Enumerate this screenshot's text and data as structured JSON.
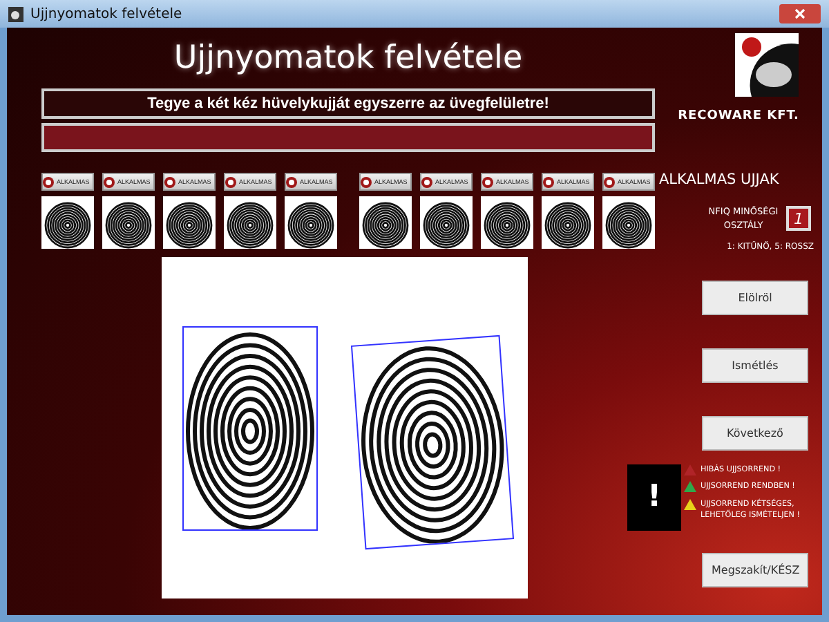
{
  "window": {
    "title": "Ujjnyomatok felvétele"
  },
  "header": {
    "title": "Ujjnyomatok felvétele",
    "instruction": "Tegye a két kéz hüvelykujját egyszerre az üvegfelületre!",
    "company": "RECOWARE KFT."
  },
  "fingers": [
    {
      "label": "ALKALMAS"
    },
    {
      "label": "ALKALMAS"
    },
    {
      "label": "ALKALMAS"
    },
    {
      "label": "ALKALMAS"
    },
    {
      "label": "ALKALMAS"
    },
    {
      "label": "ALKALMAS"
    },
    {
      "label": "ALKALMAS"
    },
    {
      "label": "ALKALMAS"
    },
    {
      "label": "ALKALMAS"
    },
    {
      "label": "ALKALMAS"
    }
  ],
  "quality": {
    "heading": "ALKALMAS UJJAK",
    "label": "NFIQ MINŐSÉGI OSZTÁLY",
    "value": "1",
    "legend": "1: KITŰNŐ, 5: ROSSZ"
  },
  "actions": [
    "Elölröl",
    "Ismétlés",
    "Következő"
  ],
  "alert": {
    "symbol": "!",
    "messages": [
      {
        "text": "HIBÁS UJJSORREND !",
        "color": "#b02428"
      },
      {
        "text": "UJJSORREND RENDBEN !",
        "color": "#2fa84a"
      },
      {
        "text": "UJJSORREND KÉTSÉGES, LEHETŐLEG ISMÉTELJEN !",
        "color": "#e8d21a"
      }
    ]
  },
  "finish_button": "Megszakít/KÉSZ"
}
